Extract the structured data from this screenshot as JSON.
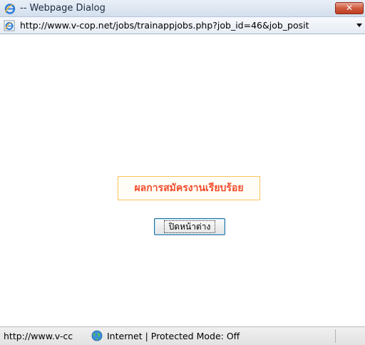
{
  "titlebar": {
    "title": "-- Webpage Dialog",
    "close_label": "✕"
  },
  "address_bar": {
    "url": "http://www.v-cop.net/jobs/trainappjobs.php?job_id=46&job_posit"
  },
  "content": {
    "result_message": "ผลการสมัครงานเรียบร้อย",
    "close_window_button": "ปิดหน้าต่าง"
  },
  "status_bar": {
    "url": "http://www.v-cc",
    "zone": "Internet | Protected Mode: Off"
  },
  "colors": {
    "result_text": "#f24c2c",
    "result_border": "#f6c35a",
    "close_button": "#cf5a3f"
  }
}
